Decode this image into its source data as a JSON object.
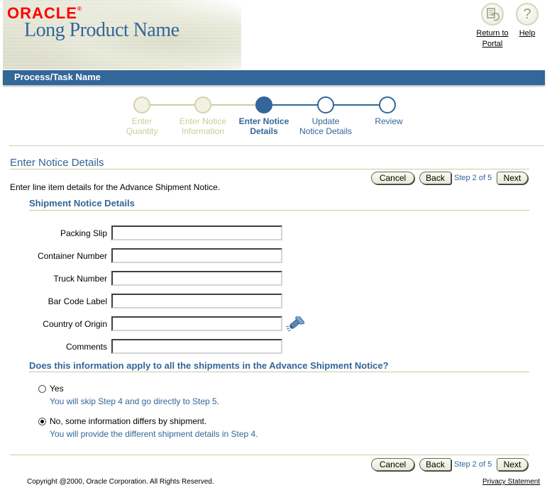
{
  "branding": {
    "logo": "ORACLE",
    "product_name": "Long Product Name"
  },
  "global_buttons": {
    "return_to_portal": "Return to Portal",
    "help": "Help"
  },
  "title_bar": "Process/Task Name",
  "train": {
    "steps": [
      {
        "label_line1": "Enter",
        "label_line2": "Quantity",
        "state": "visited"
      },
      {
        "label_line1": "Enter Notice",
        "label_line2": "Information",
        "state": "visited"
      },
      {
        "label_line1": "Enter Notice",
        "label_line2": "Details",
        "state": "current"
      },
      {
        "label_line1": "Update",
        "label_line2": "Notice Details",
        "state": "future"
      },
      {
        "label_line1": "Review",
        "label_line2": "",
        "state": "future"
      }
    ]
  },
  "page": {
    "title": "Enter Notice Details",
    "instruction": "Enter line item details for the Advance Shipment Notice.",
    "section_title": "Shipment Notice Details",
    "question": "Does this information apply to all the shipments in the Advance Shipment Notice?"
  },
  "nav": {
    "cancel": "Cancel",
    "back": "Back",
    "step": "Step 2 of 5",
    "next": "Next"
  },
  "form": {
    "fields": [
      {
        "label": "Packing Slip",
        "value": ""
      },
      {
        "label": "Container Number",
        "value": ""
      },
      {
        "label": "Truck Number",
        "value": ""
      },
      {
        "label": "Bar Code Label",
        "value": ""
      },
      {
        "label": "Country of Origin",
        "value": ""
      },
      {
        "label": "Comments",
        "value": ""
      }
    ]
  },
  "options": [
    {
      "label": "Yes",
      "tip": "You will skip Step 4 and go directly to Step 5.",
      "checked": false
    },
    {
      "label": "No, some information differs by shipment.",
      "tip": "You will provide the different shipment details in Step 4.",
      "checked": true
    }
  ],
  "footer": {
    "copyright": "Copyright @2000, Oracle Corporation. All Rights Reserved.",
    "privacy": "Privacy Statement"
  },
  "colors": {
    "accent": "#336699",
    "logo_red": "#ff0000",
    "rule": "#cccc99",
    "visited": "#cccc99"
  }
}
